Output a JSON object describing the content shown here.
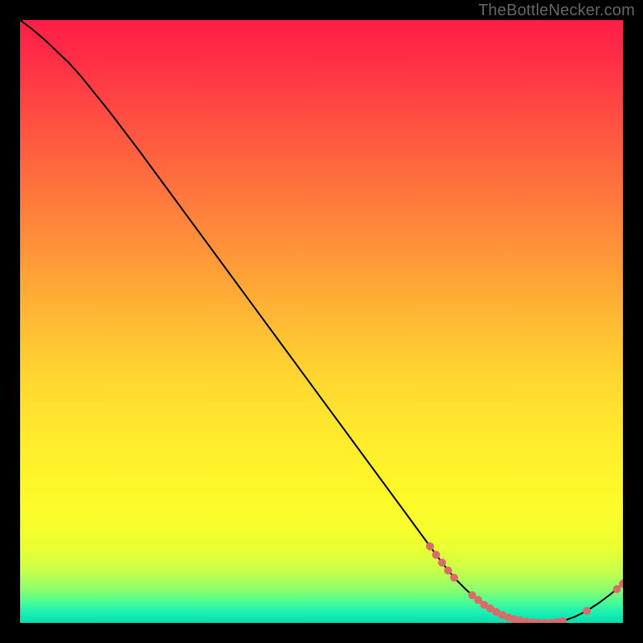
{
  "watermark": "TheBottleNecker.com",
  "chart_data": {
    "type": "line",
    "title": "",
    "xlabel": "",
    "ylabel": "",
    "xlim": [
      0,
      100
    ],
    "ylim": [
      0,
      100
    ],
    "curve": [
      {
        "x": 0,
        "y": 100
      },
      {
        "x": 2,
        "y": 98.5
      },
      {
        "x": 4,
        "y": 96.8
      },
      {
        "x": 6,
        "y": 94.9
      },
      {
        "x": 8,
        "y": 93.0
      },
      {
        "x": 10,
        "y": 90.8
      },
      {
        "x": 15,
        "y": 84.6
      },
      {
        "x": 20,
        "y": 78.0
      },
      {
        "x": 25,
        "y": 71.2
      },
      {
        "x": 30,
        "y": 64.4
      },
      {
        "x": 35,
        "y": 57.6
      },
      {
        "x": 40,
        "y": 50.8
      },
      {
        "x": 45,
        "y": 44.0
      },
      {
        "x": 50,
        "y": 37.2
      },
      {
        "x": 55,
        "y": 30.4
      },
      {
        "x": 60,
        "y": 23.6
      },
      {
        "x": 65,
        "y": 16.8
      },
      {
        "x": 68,
        "y": 12.7
      },
      {
        "x": 70,
        "y": 10.0
      },
      {
        "x": 72,
        "y": 7.5
      },
      {
        "x": 74,
        "y": 5.5
      },
      {
        "x": 76,
        "y": 3.8
      },
      {
        "x": 78,
        "y": 2.4
      },
      {
        "x": 80,
        "y": 1.3
      },
      {
        "x": 82,
        "y": 0.6
      },
      {
        "x": 84,
        "y": 0.2
      },
      {
        "x": 86,
        "y": 0.0
      },
      {
        "x": 88,
        "y": 0.0
      },
      {
        "x": 90,
        "y": 0.3
      },
      {
        "x": 92,
        "y": 1.0
      },
      {
        "x": 94,
        "y": 2.0
      },
      {
        "x": 96,
        "y": 3.3
      },
      {
        "x": 98,
        "y": 4.8
      },
      {
        "x": 100,
        "y": 6.5
      }
    ],
    "markers": [
      {
        "x": 68,
        "y": 12.7
      },
      {
        "x": 69,
        "y": 11.3
      },
      {
        "x": 70,
        "y": 10.0
      },
      {
        "x": 71,
        "y": 8.7
      },
      {
        "x": 72,
        "y": 7.5
      },
      {
        "x": 75,
        "y": 4.6
      },
      {
        "x": 76,
        "y": 3.8
      },
      {
        "x": 77,
        "y": 3.0
      },
      {
        "x": 78,
        "y": 2.4
      },
      {
        "x": 79,
        "y": 1.8
      },
      {
        "x": 80,
        "y": 1.3
      },
      {
        "x": 81,
        "y": 0.9
      },
      {
        "x": 82,
        "y": 0.6
      },
      {
        "x": 83,
        "y": 0.4
      },
      {
        "x": 84,
        "y": 0.2
      },
      {
        "x": 85,
        "y": 0.1
      },
      {
        "x": 86,
        "y": 0.0
      },
      {
        "x": 87,
        "y": 0.0
      },
      {
        "x": 88,
        "y": 0.0
      },
      {
        "x": 89,
        "y": 0.1
      },
      {
        "x": 90,
        "y": 0.3
      },
      {
        "x": 94,
        "y": 2.0
      },
      {
        "x": 99,
        "y": 5.6
      },
      {
        "x": 100,
        "y": 6.5
      }
    ],
    "marker_color": "#d96b6b",
    "marker_radius_px": 5,
    "gradient_stops": [
      {
        "offset": 0.0,
        "color": "#ff1e46"
      },
      {
        "offset": 0.05,
        "color": "#ff2a46"
      },
      {
        "offset": 0.1,
        "color": "#ff3a44"
      },
      {
        "offset": 0.15,
        "color": "#ff4a42"
      },
      {
        "offset": 0.2,
        "color": "#ff5a40"
      },
      {
        "offset": 0.25,
        "color": "#ff6a3e"
      },
      {
        "offset": 0.3,
        "color": "#ff7a3c"
      },
      {
        "offset": 0.35,
        "color": "#ff8a3a"
      },
      {
        "offset": 0.4,
        "color": "#ff9a38"
      },
      {
        "offset": 0.45,
        "color": "#ffaa36"
      },
      {
        "offset": 0.5,
        "color": "#ffba34"
      },
      {
        "offset": 0.55,
        "color": "#ffca32"
      },
      {
        "offset": 0.6,
        "color": "#ffd830"
      },
      {
        "offset": 0.65,
        "color": "#ffe22e"
      },
      {
        "offset": 0.7,
        "color": "#ffec2c"
      },
      {
        "offset": 0.75,
        "color": "#fff42a"
      },
      {
        "offset": 0.8,
        "color": "#fdfb2a"
      },
      {
        "offset": 0.85,
        "color": "#f4ff2c"
      },
      {
        "offset": 0.88,
        "color": "#e6ff34"
      },
      {
        "offset": 0.91,
        "color": "#ccff48"
      },
      {
        "offset": 0.93,
        "color": "#aaff5c"
      },
      {
        "offset": 0.95,
        "color": "#7dff78"
      },
      {
        "offset": 0.965,
        "color": "#4cfd96"
      },
      {
        "offset": 0.98,
        "color": "#20f2ae"
      },
      {
        "offset": 0.99,
        "color": "#10e8b2"
      },
      {
        "offset": 1.0,
        "color": "#0cddae"
      }
    ]
  }
}
